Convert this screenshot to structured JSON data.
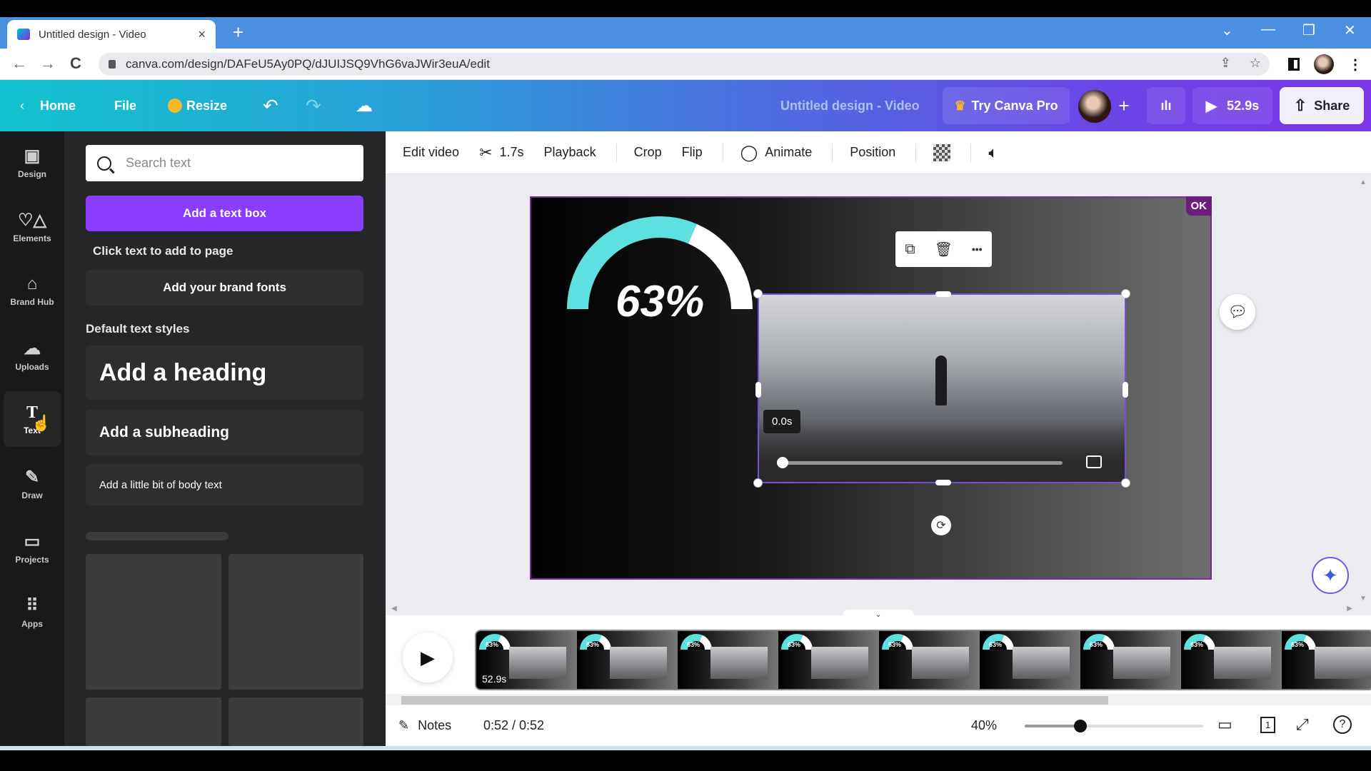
{
  "browser": {
    "tab_title": "Untitled design - Video",
    "tab_close": "×",
    "new_tab": "+",
    "url": "canva.com/design/DAFeU5Ay0PQ/dJUIJSQ9VhG6vaJWir3euA/edit",
    "window_controls": {
      "dropdown": "⌄",
      "minimize": "—",
      "restore": "❐",
      "close": "✕"
    },
    "nav": {
      "back": "←",
      "forward": "→",
      "reload": "C"
    },
    "icons": {
      "share": "⇪",
      "star": "☆",
      "more": "⋮"
    }
  },
  "header": {
    "home": "Home",
    "file": "File",
    "resize": "Resize",
    "undo": "↶",
    "redo": "↷",
    "cloud": "☁",
    "doc_title": "Untitled design - Video",
    "try_pro": "Try Canva Pro",
    "add_member": "+",
    "insights": "ılı",
    "play_duration": "52.9s",
    "share": "Share"
  },
  "rail": [
    {
      "label": "Design",
      "icon": "▣"
    },
    {
      "label": "Elements",
      "icon": "♡△"
    },
    {
      "label": "Brand Hub",
      "icon": "⌂"
    },
    {
      "label": "Uploads",
      "icon": "☁"
    },
    {
      "label": "Text",
      "icon": "T",
      "active": true
    },
    {
      "label": "Draw",
      "icon": "✎"
    },
    {
      "label": "Projects",
      "icon": "▭"
    },
    {
      "label": "Apps",
      "icon": "⠿"
    }
  ],
  "panel": {
    "search_placeholder": "Search text",
    "add_text_box": "Add a text box",
    "click_hint": "Click text to add to page",
    "brand_fonts": "Add your brand fonts",
    "default_styles_label": "Default text styles",
    "heading": "Add a heading",
    "subheading": "Add a subheading",
    "body": "Add a little bit of body text"
  },
  "toolbar": {
    "edit_video": "Edit video",
    "trim_duration": "1.7s",
    "playback": "Playback",
    "crop": "Crop",
    "flip": "Flip",
    "animate": "Animate",
    "position": "Position"
  },
  "canvas": {
    "ok_badge": "OK",
    "gauge_percent": 63,
    "gauge_label": "63%",
    "video_time": "0.0s",
    "video_progress": 0,
    "float_more": "•••",
    "colors": {
      "gauge_fill": "#5fe0e0",
      "gauge_rest": "#ffffff",
      "selection": "#7a4fd6",
      "page_border": "#7b2f8e"
    }
  },
  "timeline": {
    "frame_label": "63%",
    "frame_count": 9,
    "duration": "52.9s"
  },
  "bottombar": {
    "notes": "Notes",
    "time": "0:52 / 0:52",
    "zoom": "40%",
    "zoom_value": 0.4,
    "page_count": "1",
    "help": "?"
  }
}
